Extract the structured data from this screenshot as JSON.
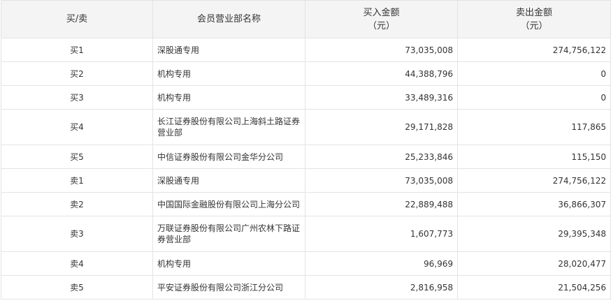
{
  "table": {
    "headers": {
      "rank": "买/卖",
      "name": "会员营业部名称",
      "buy": "买入金额",
      "buy_unit": "（元）",
      "sell": "卖出金额",
      "sell_unit": "（元）"
    },
    "rows": [
      {
        "rank": "买1",
        "name": "深股通专用",
        "buy": "73,035,008",
        "sell": "274,756,122"
      },
      {
        "rank": "买2",
        "name": "机构专用",
        "buy": "44,388,796",
        "sell": "0"
      },
      {
        "rank": "买3",
        "name": "机构专用",
        "buy": "33,489,316",
        "sell": "0"
      },
      {
        "rank": "买4",
        "name": "长江证券股份有限公司上海斜土路证券营业部",
        "buy": "29,171,828",
        "sell": "117,865"
      },
      {
        "rank": "买5",
        "name": "中信证券股份有限公司金华分公司",
        "buy": "25,233,846",
        "sell": "115,150"
      },
      {
        "rank": "卖1",
        "name": "深股通专用",
        "buy": "73,035,008",
        "sell": "274,756,122"
      },
      {
        "rank": "卖2",
        "name": "中国国际金融股份有限公司上海分公司",
        "buy": "22,889,488",
        "sell": "36,866,307"
      },
      {
        "rank": "卖3",
        "name": "万联证券股份有限公司广州农林下路证券营业部",
        "buy": "1,607,773",
        "sell": "29,395,348"
      },
      {
        "rank": "卖4",
        "name": "机构专用",
        "buy": "96,969",
        "sell": "28,020,477"
      },
      {
        "rank": "卖5",
        "name": "平安证券股份有限公司浙江分公司",
        "buy": "2,816,958",
        "sell": "21,504,256"
      }
    ]
  }
}
